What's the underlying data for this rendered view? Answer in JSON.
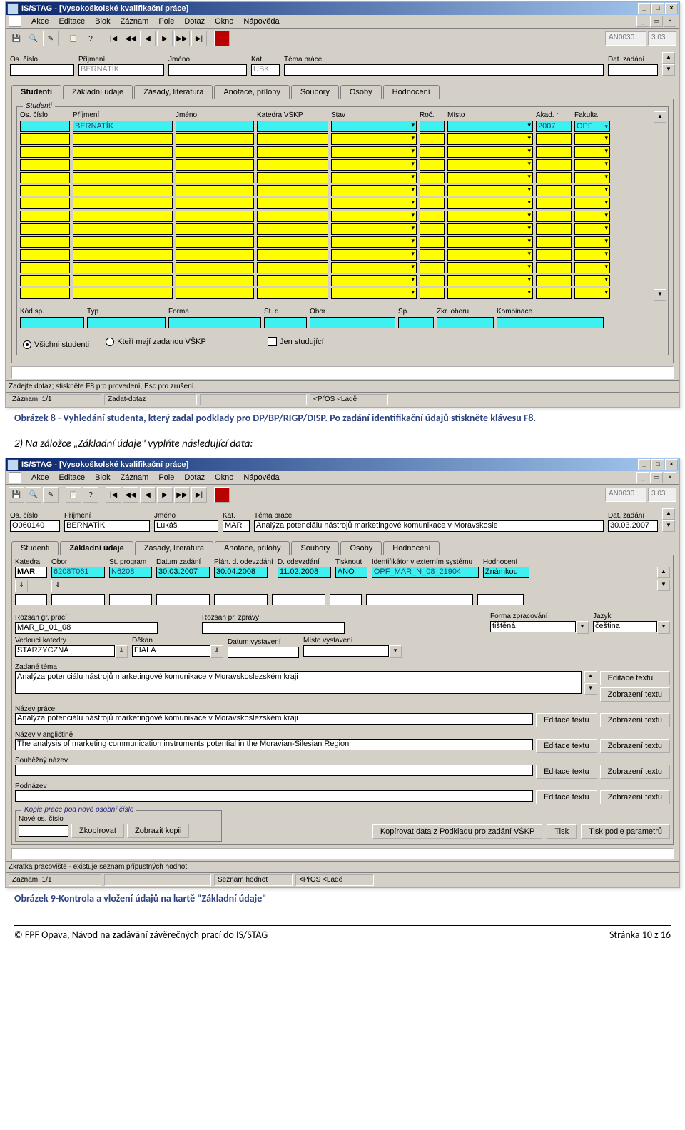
{
  "doc": {
    "caption1": "Obrázek 8 - Vyhledání studenta, který zadal podklady pro DP/BP/RIGP/DISP. Po zadání identifikační údajů stiskněte klávesu F8.",
    "body1": "2) Na záložce „Základní údaje\" vyplňte následující data:",
    "caption2": "Obrázek 9-Kontrola a vložení údajů na kartě \"Základní údaje\"",
    "footer_left": "© FPF Opava, Návod na zadávání závěrečných prací do IS/STAG",
    "footer_right": "Stránka 10 z 16"
  },
  "shot1": {
    "title": "IS/STAG - [Vysokoškolské kvalifikační práce]",
    "menus": [
      "Akce",
      "Editace",
      "Blok",
      "Záznam",
      "Pole",
      "Dotaz",
      "Okno",
      "Nápověda"
    ],
    "status_right1": "AN0030",
    "status_right2": "3.03",
    "top_fields": {
      "os": {
        "label": "Os. číslo",
        "value": ""
      },
      "prijmeni": {
        "label": "Příjmení",
        "value": "BERNATÍK"
      },
      "jmeno": {
        "label": "Jméno",
        "value": ""
      },
      "kat": {
        "label": "Kat.",
        "value": "UBK"
      },
      "tema": {
        "label": "Téma práce",
        "value": ""
      },
      "dat": {
        "label": "Dat. zadání",
        "value": ""
      }
    },
    "tabs": [
      "Studenti",
      "Základní údaje",
      "Zásady, literatura",
      "Anotace, přílohy",
      "Soubory",
      "Osoby",
      "Hodnocení"
    ],
    "active_tab": 0,
    "group_legend": "Studenti",
    "grid_headers": [
      "Os. číslo",
      "Příjmení",
      "Jméno",
      "Katedra VŠKP",
      "Stav",
      "Roč.",
      "Místo",
      "Akad. r.",
      "Fakulta"
    ],
    "grid_first": {
      "prijmeni": "BERNATÍK",
      "akad": "2007",
      "fakulta": "OPF"
    },
    "bottom_headers": [
      "Kód sp.",
      "Typ",
      "Forma",
      "St. d.",
      "Obor",
      "Sp.",
      "Zkr. oboru",
      "Kombinace"
    ],
    "radio1": "Všichni studenti",
    "radio2": "Kteří mají zadanou VŠKP",
    "check1": "Jen studující",
    "status_hint": "Zadejte dotaz; stiskněte F8 pro provedení, Esc pro zrušení.",
    "status_zaznam": "Záznam: 1/1",
    "status_zadat": "Zadat-dotaz",
    "status_pfos": "<PřOS <Ladě"
  },
  "shot2": {
    "title": "IS/STAG - [Vysokoškolské kvalifikační práce]",
    "menus": [
      "Akce",
      "Editace",
      "Blok",
      "Záznam",
      "Pole",
      "Dotaz",
      "Okno",
      "Nápověda"
    ],
    "status_right1": "AN0030",
    "status_right2": "3.03",
    "top_fields": {
      "os": {
        "label": "Os. číslo",
        "value": "O060140"
      },
      "prijmeni": {
        "label": "Příjmení",
        "value": "BERNATÍK"
      },
      "jmeno": {
        "label": "Jméno",
        "value": "Lukáš"
      },
      "kat": {
        "label": "Kat.",
        "value": "MAR"
      },
      "tema": {
        "label": "Téma práce",
        "value": "Analýza potenciálu nástrojů marketingové komunikace v Moravskosle"
      },
      "dat": {
        "label": "Dat. zadání",
        "value": "30.03.2007"
      }
    },
    "tabs": [
      "Studenti",
      "Základní údaje",
      "Zásady, literatura",
      "Anotace, přílohy",
      "Soubory",
      "Osoby",
      "Hodnocení"
    ],
    "active_tab": 1,
    "row1": {
      "katedra": {
        "label": "Katedra",
        "value": "MAR"
      },
      "obor": {
        "label": "Obor",
        "value": "6208T061"
      },
      "stprog": {
        "label": "St. program",
        "value": "N6208"
      },
      "datum_zadani": {
        "label": "Datum zadání",
        "value": "30.03.2007"
      },
      "plan_odev": {
        "label": "Plán. d. odevzdání",
        "value": "30.04.2008"
      },
      "d_odev": {
        "label": "D. odevzdání",
        "value": "11.02.2008"
      },
      "tisknout": {
        "label": "Tisknout",
        "value": "ANO"
      },
      "ident": {
        "label": "Identifikátor v externím systému",
        "value": "OPF_MAR_N_08_21904"
      },
      "hodn": {
        "label": "Hodnocení",
        "value": "Známkou"
      }
    },
    "row2": {
      "rozsah_gr": {
        "label": "Rozsah gr. prací",
        "value": "MAR_D_01_08"
      },
      "rozsah_pr": {
        "label": "Rozsah pr. zprávy",
        "value": ""
      },
      "forma": {
        "label": "Forma zpracování",
        "value": "tištěná"
      },
      "jazyk": {
        "label": "Jazyk",
        "value": "čeština"
      }
    },
    "row3": {
      "vedouci": {
        "label": "Vedoucí katedry",
        "value": "STARZYCZNÁ"
      },
      "dekan": {
        "label": "Děkan",
        "value": "FIALA"
      },
      "datum_vyst": {
        "label": "Datum vystavení",
        "value": ""
      },
      "misto_vyst": {
        "label": "Místo vystavení",
        "value": ""
      }
    },
    "zadane_tema": {
      "label": "Zadané téma",
      "value": "Analýza potenciálu nástrojů marketingové komunikace v Moravskoslezském kraji"
    },
    "nazev": {
      "label": "Název práce",
      "value": "Analýza potenciálu nástrojů marketingové komunikace v Moravskoslezském kraji"
    },
    "nazev_en": {
      "label": "Název v angličtině",
      "value": "The analysis of marketing communication instruments potential in the Moravian-Silesian Region"
    },
    "soubez": {
      "label": "Souběžný název",
      "value": ""
    },
    "podnazev": {
      "label": "Podnázev",
      "value": ""
    },
    "btn_edit": "Editace textu",
    "btn_view": "Zobrazení textu",
    "kopie_legend": "Kopie práce pod nové osobní číslo",
    "nove_os": "Nové os. číslo",
    "btn_zkop": "Zkopírovat",
    "btn_zobrazkop": "Zobrazit kopii",
    "btn_kopdata": "Kopírovat data z Podkladu pro zadání VŠKP",
    "btn_tisk": "Tisk",
    "btn_tiskparam": "Tisk podle parametrů",
    "status_hint": "Zkratka pracoviště - existuje seznam přípustných hodnot",
    "status_zaznam": "Záznam: 1/1",
    "status_seznam": "Seznam hodnot",
    "status_pfos": "<PřOS <Ladě"
  }
}
